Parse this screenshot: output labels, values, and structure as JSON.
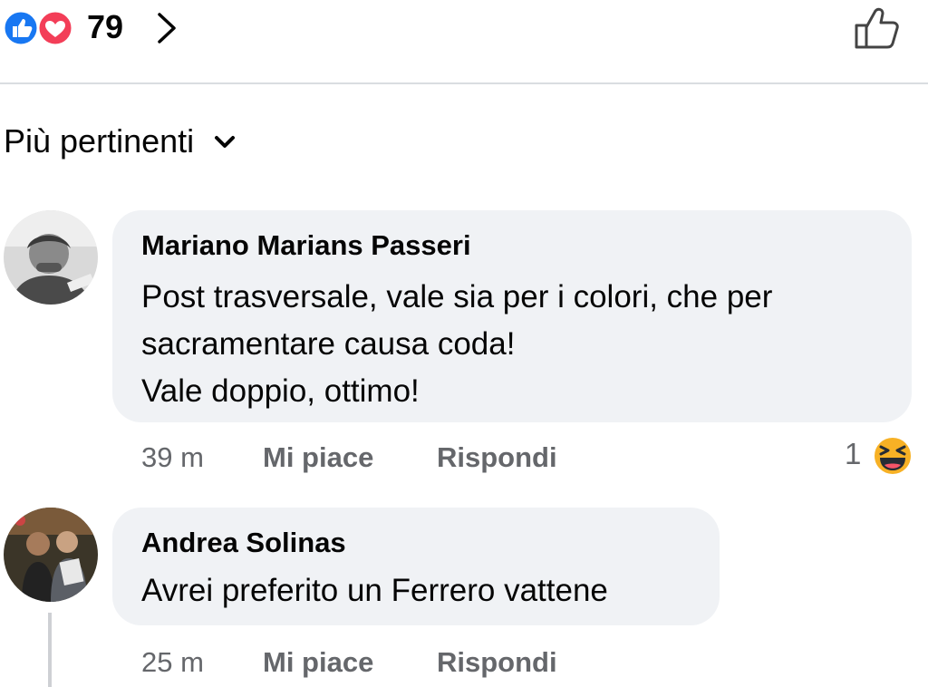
{
  "reactions": {
    "count": "79",
    "icons": [
      "like-icon",
      "love-icon"
    ]
  },
  "sort_label": "Più pertinenti",
  "comments": [
    {
      "author": "Mariano Marians Passeri",
      "lines": [
        "Post trasversale, vale sia per i colori, che per",
        "sacramentare causa coda!",
        "Vale doppio, ottimo!"
      ],
      "time": "39 m",
      "like_label": "Mi piace",
      "reply_label": "Rispondi",
      "reaction_count": "1",
      "reaction_icon": "haha-icon"
    },
    {
      "author": "Andrea Solinas",
      "lines": [
        "Avrei preferito un Ferrero vattene"
      ],
      "time": "25 m",
      "like_label": "Mi piace",
      "reply_label": "Rispondi"
    }
  ],
  "colors": {
    "bubble": "#f0f2f5",
    "meta_text": "#65676b",
    "like_blue": "#1877f2",
    "love_red": "#f33e58"
  }
}
